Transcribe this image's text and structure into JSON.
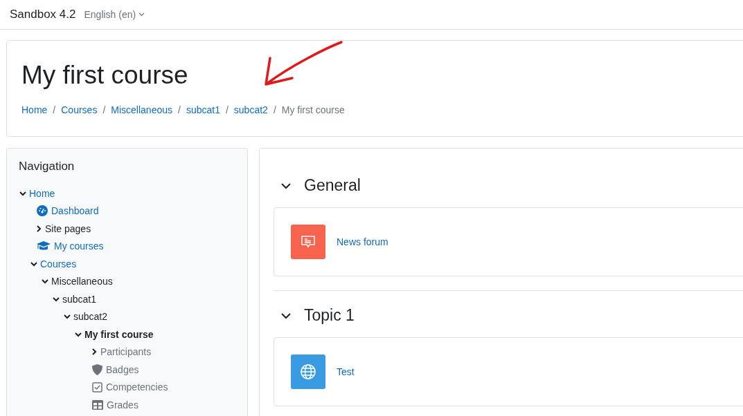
{
  "navbar": {
    "site_name": "Sandbox 4.2",
    "language": "English (en)"
  },
  "header": {
    "title": "My first course",
    "breadcrumb": [
      {
        "label": "Home",
        "link": true
      },
      {
        "separator": "/",
        "label": "Courses",
        "link": true
      },
      {
        "separator": "/",
        "label": "Miscellaneous",
        "link": true
      },
      {
        "separator": "/",
        "label": "subcat1",
        "link": true
      },
      {
        "separator": "/",
        "label": "subcat2",
        "link": true
      },
      {
        "separator": "/",
        "label": "My first course",
        "link": false
      }
    ]
  },
  "navigation": {
    "title": "Navigation",
    "items": [
      {
        "label": "Home",
        "link": true,
        "expanded": true,
        "children": [
          {
            "label": "Dashboard",
            "link": true,
            "kind": "dashboard"
          },
          {
            "label": "Site pages",
            "link": false,
            "expanded": false
          },
          {
            "label": "My courses",
            "link": true,
            "kind": "courses"
          },
          {
            "label": "Courses",
            "link": true,
            "expanded": true,
            "children": [
              {
                "label": "Miscellaneous",
                "link": false,
                "expanded": true,
                "children": [
                  {
                    "label": "subcat1",
                    "link": false,
                    "expanded": true,
                    "children": [
                      {
                        "label": "subcat2",
                        "link": false,
                        "expanded": true,
                        "children": [
                          {
                            "label": "My first course",
                            "link": false,
                            "current": true,
                            "expanded": true,
                            "children": [
                              {
                                "label": "Participants",
                                "link": false,
                                "muted": true,
                                "expanded": false
                              },
                              {
                                "label": "Badges",
                                "link": false,
                                "muted": true,
                                "kind": "badge"
                              },
                              {
                                "label": "Competencies",
                                "link": false,
                                "muted": true,
                                "kind": "competency"
                              },
                              {
                                "label": "Grades",
                                "link": false,
                                "muted": true,
                                "kind": "grades"
                              }
                            ]
                          }
                        ]
                      }
                    ]
                  }
                ]
              }
            ]
          }
        ]
      }
    ]
  },
  "sections": [
    {
      "title": "General",
      "expanded": true,
      "activities": [
        {
          "name": "News forum",
          "kind": "forum"
        }
      ]
    },
    {
      "title": "Topic 1",
      "expanded": true,
      "activities": [
        {
          "name": "Test",
          "kind": "url"
        }
      ]
    }
  ]
}
